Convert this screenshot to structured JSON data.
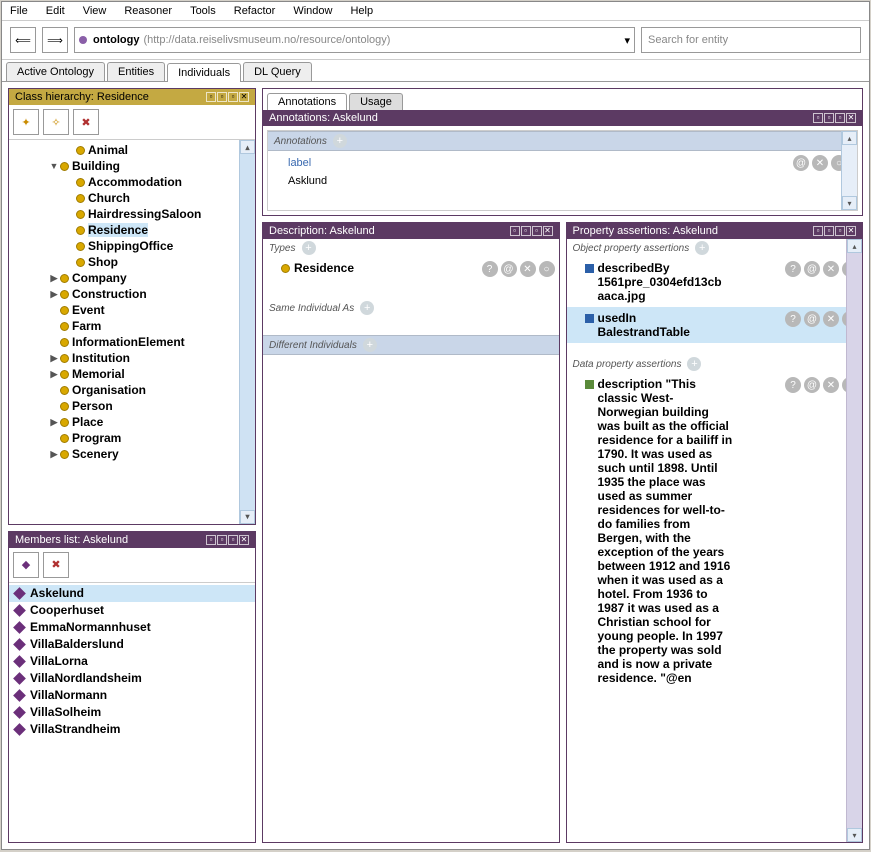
{
  "menu": [
    "File",
    "Edit",
    "View",
    "Reasoner",
    "Tools",
    "Refactor",
    "Window",
    "Help"
  ],
  "ontology": {
    "name": "ontology",
    "uri": "(http://data.reiselivsmuseum.no/resource/ontology)"
  },
  "search_placeholder": "Search for entity",
  "main_tabs": [
    "Active Ontology",
    "Entities",
    "Individuals",
    "DL Query"
  ],
  "main_tab_active": 2,
  "class_hierarchy": {
    "title": "Class hierarchy: Residence",
    "items": [
      {
        "indent": 2,
        "twisty": "",
        "label": "Animal"
      },
      {
        "indent": 1,
        "twisty": "▼",
        "label": "Building"
      },
      {
        "indent": 2,
        "twisty": "",
        "label": "Accommodation"
      },
      {
        "indent": 2,
        "twisty": "",
        "label": "Church"
      },
      {
        "indent": 2,
        "twisty": "",
        "label": "HairdressingSaloon"
      },
      {
        "indent": 2,
        "twisty": "",
        "label": "Residence",
        "selected": true
      },
      {
        "indent": 2,
        "twisty": "",
        "label": "ShippingOffice"
      },
      {
        "indent": 2,
        "twisty": "",
        "label": "Shop"
      },
      {
        "indent": 1,
        "twisty": "▶",
        "label": "Company"
      },
      {
        "indent": 1,
        "twisty": "▶",
        "label": "Construction"
      },
      {
        "indent": 1,
        "twisty": "",
        "label": "Event"
      },
      {
        "indent": 1,
        "twisty": "",
        "label": "Farm"
      },
      {
        "indent": 1,
        "twisty": "",
        "label": "InformationElement"
      },
      {
        "indent": 1,
        "twisty": "▶",
        "label": "Institution"
      },
      {
        "indent": 1,
        "twisty": "▶",
        "label": "Memorial"
      },
      {
        "indent": 1,
        "twisty": "",
        "label": "Organisation"
      },
      {
        "indent": 1,
        "twisty": "",
        "label": "Person"
      },
      {
        "indent": 1,
        "twisty": "▶",
        "label": "Place"
      },
      {
        "indent": 1,
        "twisty": "",
        "label": "Program"
      },
      {
        "indent": 1,
        "twisty": "▶",
        "label": "Scenery"
      }
    ]
  },
  "members": {
    "title": "Members list: Askelund",
    "items": [
      {
        "label": "Askelund",
        "selected": true
      },
      {
        "label": "Cooperhuset"
      },
      {
        "label": "EmmaNormannhuset"
      },
      {
        "label": "VillaBalderslund"
      },
      {
        "label": "VillaLorna"
      },
      {
        "label": "VillaNordlandsheim"
      },
      {
        "label": "VillaNormann"
      },
      {
        "label": "VillaSolheim"
      },
      {
        "label": "VillaStrandheim"
      }
    ]
  },
  "anno_tabs": [
    "Annotations",
    "Usage"
  ],
  "annotations": {
    "title": "Annotations: Askelund",
    "section": "Annotations",
    "label_key": "label",
    "label_value": "Asklund"
  },
  "description": {
    "title": "Description: Askelund",
    "types_label": "Types",
    "type_value": "Residence",
    "same_as_label": "Same Individual As",
    "diff_label": "Different Individuals"
  },
  "property": {
    "title": "Property assertions: Askelund",
    "obj_label": "Object property assertions",
    "obj_items": [
      {
        "text": "describedBy 1561pre_0304efd13cbaaca.jpg"
      },
      {
        "text": "usedIn BalestrandTable",
        "selected": true
      }
    ],
    "data_label": "Data property assertions",
    "data_items": [
      {
        "prop": "description",
        "val": "\"This classic West-Norwegian building was built as the official residence for a bailiff in 1790. It was used as such until 1898. Until 1935 the place was used as summer residences for well-to-do families from Bergen, with the exception of the years between 1912 and 1916 when it was used as a hotel. From 1936 to 1987 it was used as a Christian school for young people. In 1997 the property was sold and is now a private residence. \"@en"
      }
    ]
  }
}
